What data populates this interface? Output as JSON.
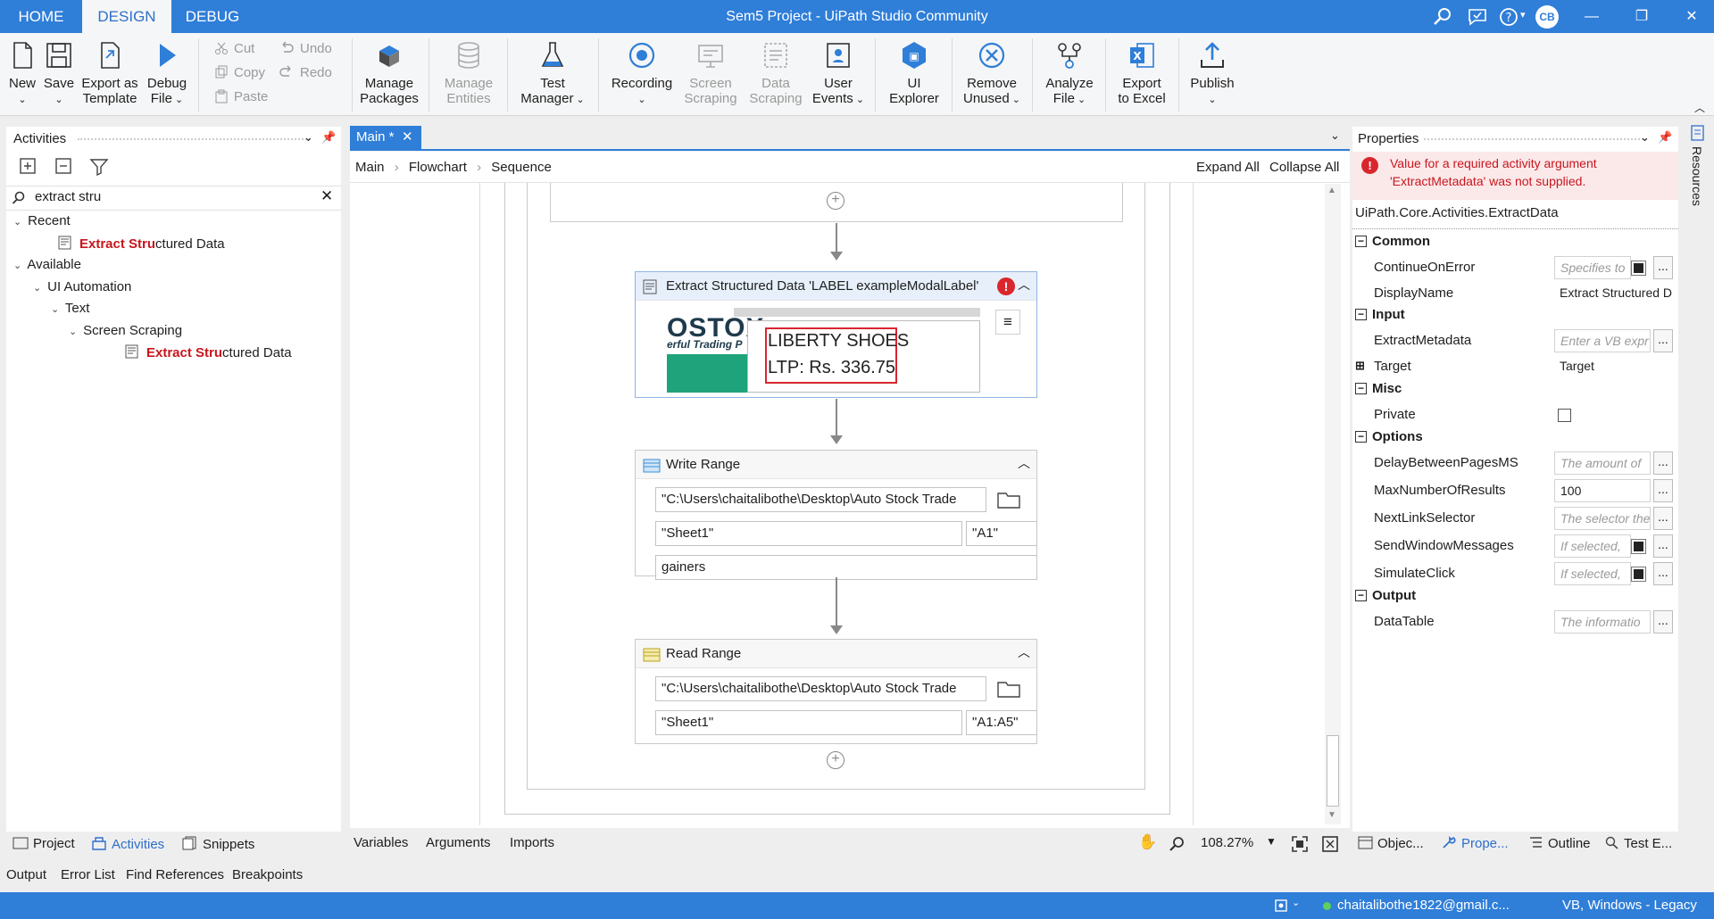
{
  "app_title": "Sem5 Project - UiPath Studio Community",
  "top_tabs": [
    {
      "label": "HOME"
    },
    {
      "label": "DESIGN"
    },
    {
      "label": "DEBUG"
    }
  ],
  "user_initials": "CB",
  "ribbon": {
    "new": "New",
    "save": "Save",
    "export_template_1": "Export as",
    "export_template_2": "Template",
    "debug_1": "Debug",
    "debug_2": "File",
    "cut": "Cut",
    "copy": "Copy",
    "paste": "Paste",
    "undo": "Undo",
    "redo": "Redo",
    "manage_packages_1": "Manage",
    "manage_packages_2": "Packages",
    "manage_entities_1": "Manage",
    "manage_entities_2": "Entities",
    "test_manager_1": "Test",
    "test_manager_2": "Manager",
    "recording": "Recording",
    "screen_scraping_1": "Screen",
    "screen_scraping_2": "Scraping",
    "data_scraping_1": "Data",
    "data_scraping_2": "Scraping",
    "user_events_1": "User",
    "user_events_2": "Events",
    "ui_explorer_1": "UI",
    "ui_explorer_2": "Explorer",
    "remove_unused_1": "Remove",
    "remove_unused_2": "Unused",
    "analyze_file_1": "Analyze",
    "analyze_file_2": "File",
    "export_excel_1": "Export",
    "export_excel_2": "to Excel",
    "publish": "Publish"
  },
  "activities_panel": {
    "title": "Activities",
    "search_value": "extract stru",
    "recent_label": "Recent",
    "recent_item_hl": "Extract Stru",
    "recent_item_rest": "ctured Data",
    "available_label": "Available",
    "ui_automation": "UI Automation",
    "text": "Text",
    "screen_scraping": "Screen Scraping",
    "leaf_hl": "Extract Stru",
    "leaf_rest": "ctured Data"
  },
  "left_bottom_tabs": {
    "project": "Project",
    "activities": "Activities",
    "snippets": "Snippets"
  },
  "output_tabs": {
    "output": "Output",
    "error_list": "Error List",
    "find_references": "Find References",
    "breakpoints": "Breakpoints"
  },
  "designer": {
    "tab_label": "Main *",
    "breadcrumb": [
      "Main",
      "Flowchart",
      "Sequence"
    ],
    "expand_all": "Expand All",
    "collapse_all": "Collapse All",
    "extract_title": "Extract Structured Data 'LABEL  exampleModalLabel'",
    "preview_line1": "LIBERTY SHOES",
    "preview_line2": "LTP: Rs. 336.75",
    "preview_logo": "OSTOX",
    "preview_logo_sub": "erful Trading P",
    "write_range": {
      "title": "Write Range",
      "path": "\"C:\\Users\\chaitalibothe\\Desktop\\Auto Stock Trade",
      "sheet": "\"Sheet1\"",
      "cell": "\"A1\"",
      "data": "gainers"
    },
    "read_range": {
      "title": "Read Range",
      "path": "\"C:\\Users\\chaitalibothe\\Desktop\\Auto Stock Trade",
      "sheet": "\"Sheet1\"",
      "range": "\"A1:A5\""
    },
    "bottom_tabs": {
      "variables": "Variables",
      "arguments": "Arguments",
      "imports": "Imports"
    },
    "zoom": "108.27%"
  },
  "properties": {
    "title": "Properties",
    "error_line1": "Value for a required activity argument",
    "error_line2": "'ExtractMetadata' was not supplied.",
    "type_name": "UiPath.Core.Activities.ExtractData",
    "categories": {
      "common": "Common",
      "input": "Input",
      "misc": "Misc",
      "options": "Options",
      "output": "Output"
    },
    "continue_on_error": {
      "name": "ContinueOnError",
      "placeholder": "Specifies to"
    },
    "display_name": {
      "name": "DisplayName",
      "value": "Extract Structured D"
    },
    "extract_metadata": {
      "name": "ExtractMetadata",
      "placeholder": "Enter a VB expr"
    },
    "target": {
      "name": "Target",
      "value": "Target"
    },
    "private": {
      "name": "Private"
    },
    "delay": {
      "name": "DelayBetweenPagesMS",
      "placeholder": "The amount of"
    },
    "max_results": {
      "name": "MaxNumberOfResults",
      "value": "100"
    },
    "next_link": {
      "name": "NextLinkSelector",
      "placeholder": "The selector the"
    },
    "send_window": {
      "name": "SendWindowMessages",
      "placeholder": "If selected,"
    },
    "simulate_click": {
      "name": "SimulateClick",
      "placeholder": "If selected,"
    },
    "data_table": {
      "name": "DataTable",
      "placeholder": "The informatio"
    },
    "bottom_tabs": {
      "object": "Objec...",
      "properties": "Prope...",
      "outline": "Outline",
      "test": "Test E..."
    }
  },
  "resources_label": "Resources",
  "status": {
    "email": "chaitalibothe1822@gmail.c...",
    "mode": "VB, Windows - Legacy"
  }
}
